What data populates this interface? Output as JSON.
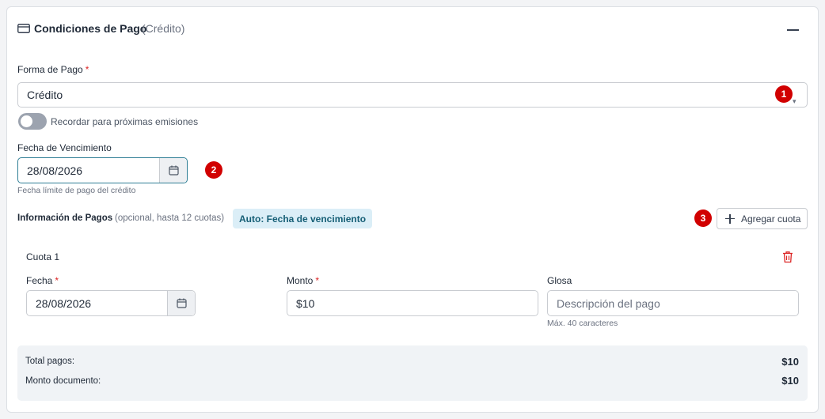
{
  "header": {
    "title": "Condiciones de Pago",
    "subtitle": "(Crédito)"
  },
  "forma_pago": {
    "label": "Forma de Pago",
    "required_mark": "*",
    "value": "Crédito",
    "badge": "1"
  },
  "remember": {
    "label": "Recordar para próximas emisiones",
    "on": false
  },
  "vencimiento": {
    "label": "Fecha de Vencimiento",
    "value": "28/08/2026",
    "hint": "Fecha límite de pago del crédito",
    "badge": "2"
  },
  "pagos": {
    "title": "Información de Pagos",
    "subtitle": "(opcional, hasta 12 cuotas)",
    "auto_tag": "Auto: Fecha de vencimiento",
    "add_button": "Agregar cuota",
    "badge": "3"
  },
  "cuota": {
    "title": "Cuota 1",
    "fecha_label": "Fecha",
    "fecha_value": "28/08/2026",
    "monto_label": "Monto",
    "monto_value": "$10",
    "glosa_label": "Glosa",
    "glosa_placeholder": "Descripción del pago",
    "glosa_hint": "Máx. 40 caracteres",
    "required_mark": "*"
  },
  "totals": {
    "total_label": "Total pagos:",
    "total_value": "$10",
    "doc_label": "Monto documento:",
    "doc_value": "$10"
  },
  "colors": {
    "accent": "#2f7e95",
    "badge": "#d10000",
    "required": "#dc2626",
    "tag_bg": "#dbeef7"
  }
}
